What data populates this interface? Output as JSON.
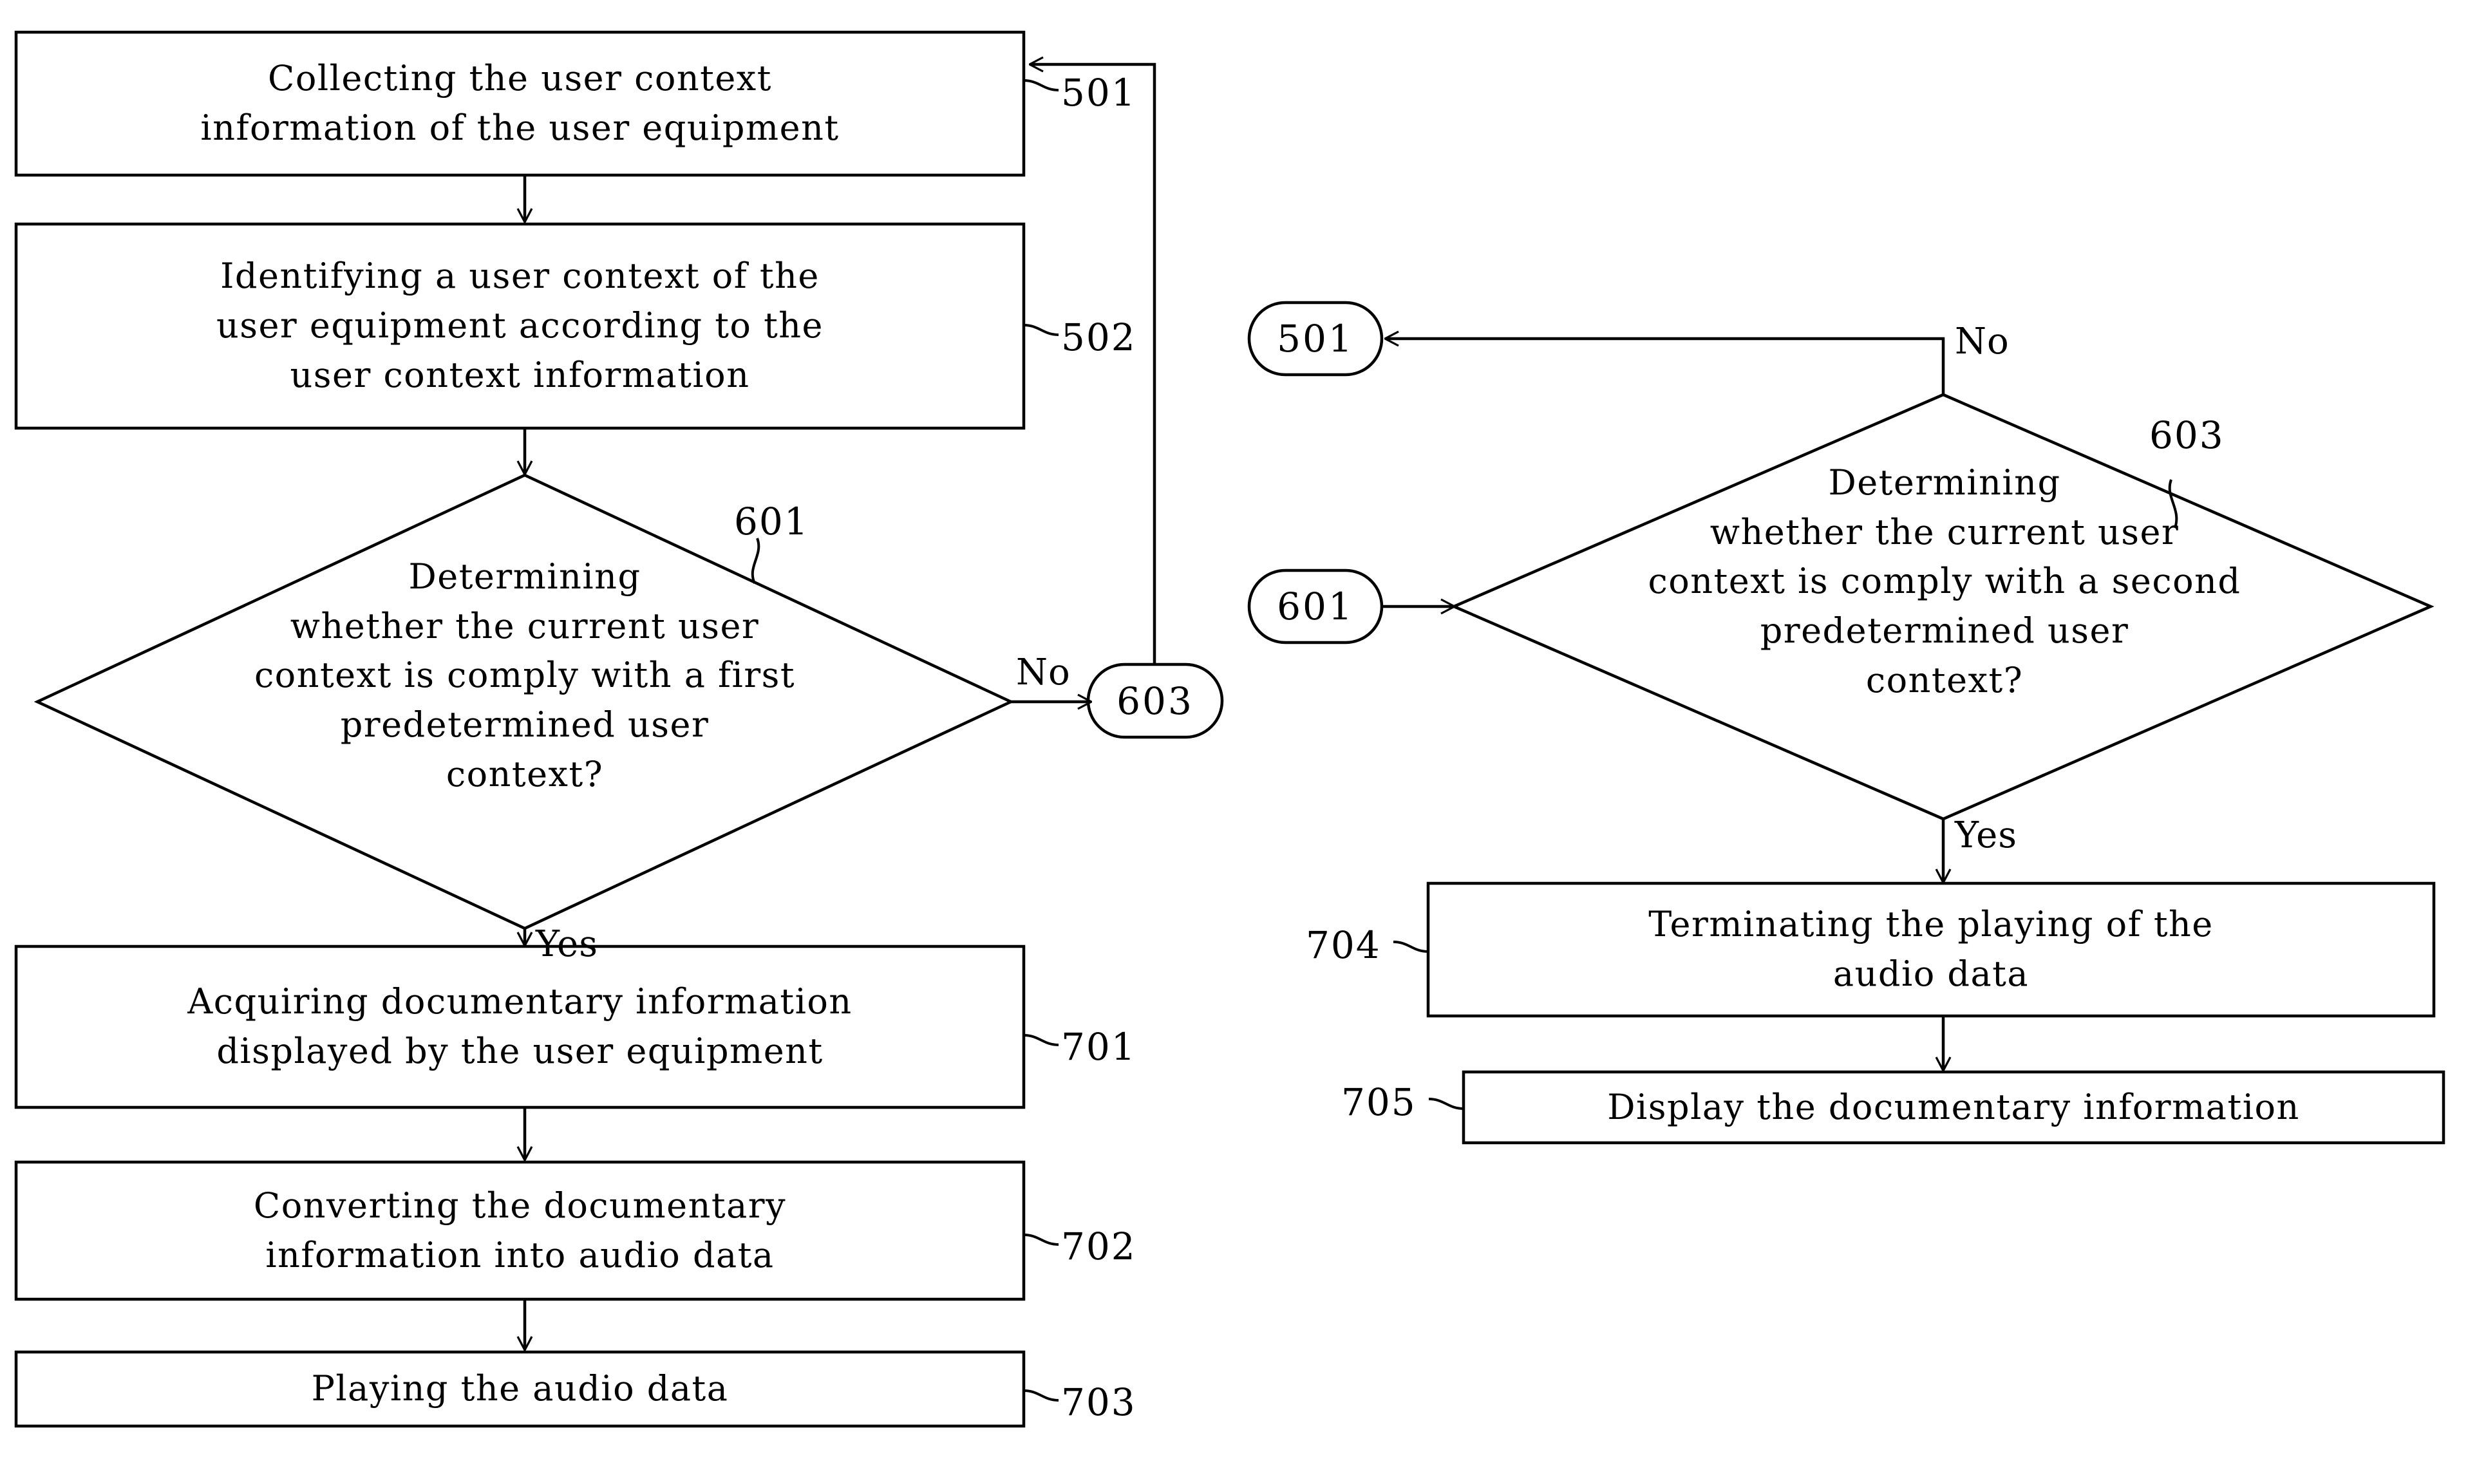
{
  "figure": {
    "background_color": "#ffffff",
    "stroke_color": "#000000",
    "type": "patent-flowchart"
  },
  "left_flow": {
    "step_501": {
      "text": "Collecting the user context\ninformation of the user equipment",
      "ref": "501"
    },
    "step_502": {
      "text": "Identifying a user context of the\nuser equipment according to the\nuser context information",
      "ref": "502"
    },
    "decision_601": {
      "text": "Determining\nwhether the current user\ncontext is comply with a first\npredetermined user\ncontext?",
      "ref": "601",
      "no_label": "No",
      "yes_label": "Yes"
    },
    "connector_603": {
      "text": "603"
    },
    "step_701": {
      "text": "Acquiring documentary information\ndisplayed by the user equipment",
      "ref": "701"
    },
    "step_702": {
      "text": "Converting the documentary\ninformation into audio data",
      "ref": "702"
    },
    "step_703": {
      "text": "Playing the audio data",
      "ref": "703"
    }
  },
  "right_flow": {
    "connector_501": {
      "text": "501"
    },
    "connector_601": {
      "text": "601"
    },
    "decision_603": {
      "text": "Determining\nwhether the current user\ncontext is comply with a second\npredetermined user\ncontext?",
      "ref": "603",
      "no_label": "No",
      "yes_label": "Yes"
    },
    "step_704": {
      "text": "Terminating the playing of the\naudio data",
      "ref": "704"
    },
    "step_705": {
      "text": "Display the documentary information",
      "ref": "705"
    }
  }
}
